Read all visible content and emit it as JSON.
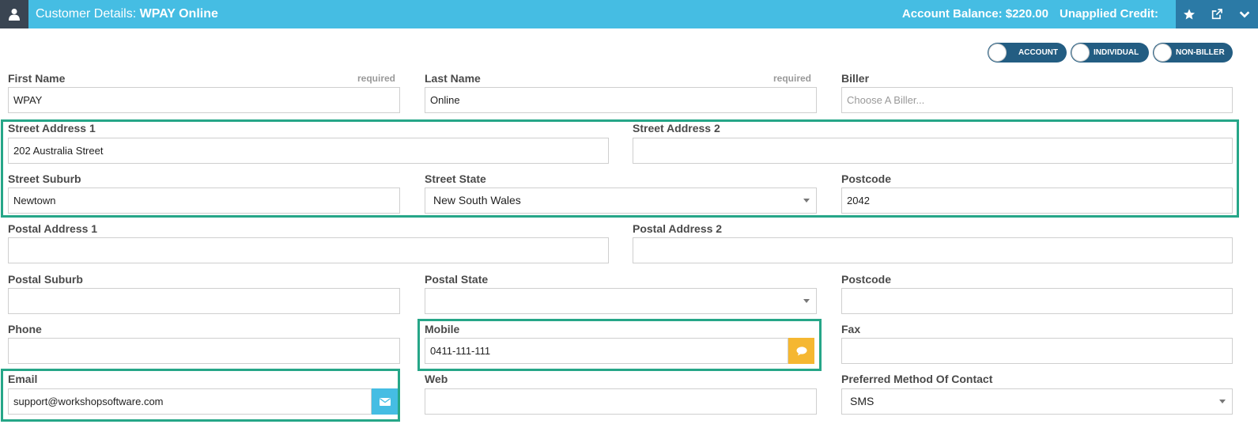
{
  "header": {
    "title_prefix": "Customer Details:",
    "customer_name": "WPAY Online",
    "account_balance": "Account Balance: $220.00",
    "unapplied_credit": "Unapplied Credit:",
    "icons": [
      "user-icon",
      "star-icon",
      "external-link-icon",
      "chevron-down-icon"
    ]
  },
  "toggles": {
    "account": "ACCOUNT",
    "individual": "INDIVIDUAL",
    "non_biller": "NON-BILLER"
  },
  "form": {
    "first_name": {
      "label": "First Name",
      "required": "required",
      "value": "WPAY"
    },
    "last_name": {
      "label": "Last Name",
      "required": "required",
      "value": "Online"
    },
    "biller": {
      "label": "Biller",
      "placeholder": "Choose A Biller..."
    },
    "street_address_1": {
      "label": "Street Address 1",
      "value": "202 Australia Street"
    },
    "street_address_2": {
      "label": "Street Address 2",
      "value": ""
    },
    "street_suburb": {
      "label": "Street Suburb",
      "value": "Newtown"
    },
    "street_state": {
      "label": "Street State",
      "value": "New South Wales"
    },
    "street_postcode": {
      "label": "Postcode",
      "value": "2042"
    },
    "postal_address_1": {
      "label": "Postal Address 1",
      "value": ""
    },
    "postal_address_2": {
      "label": "Postal Address 2",
      "value": ""
    },
    "postal_suburb": {
      "label": "Postal Suburb",
      "value": ""
    },
    "postal_state": {
      "label": "Postal State",
      "value": ""
    },
    "postal_postcode": {
      "label": "Postcode",
      "value": ""
    },
    "phone": {
      "label": "Phone",
      "value": ""
    },
    "mobile": {
      "label": "Mobile",
      "value": "0411-111-111"
    },
    "fax": {
      "label": "Fax",
      "value": ""
    },
    "email": {
      "label": "Email",
      "value": "support@workshopsoftware.com"
    },
    "web": {
      "label": "Web",
      "value": ""
    },
    "preferred_contact": {
      "label": "Preferred Method Of Contact",
      "value": "SMS"
    }
  },
  "colors": {
    "header_bg": "#45bde3",
    "header_dark": "#3a4552",
    "icon_bar": "#2b7aa6",
    "toggle_bg": "#235d82",
    "highlight": "#26a688",
    "sms_button": "#f5b731",
    "email_button": "#45bde3"
  }
}
